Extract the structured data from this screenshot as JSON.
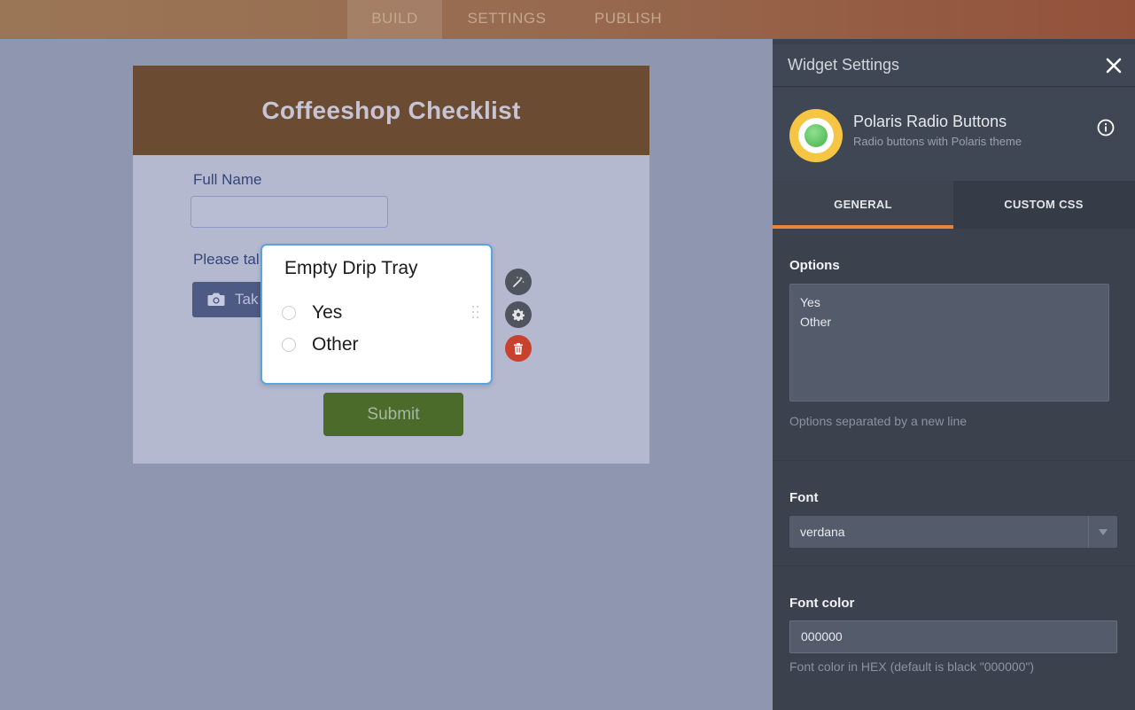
{
  "topbar": {
    "tabs": [
      {
        "label": "BUILD",
        "active": true
      },
      {
        "label": "SETTINGS",
        "active": false
      },
      {
        "label": "PUBLISH",
        "active": false
      }
    ]
  },
  "form": {
    "title": "Coffeeshop Checklist",
    "full_name_label": "Full Name",
    "photo_label": "Please tal",
    "photo_button": "Tak",
    "submit": "Submit"
  },
  "radio_widget": {
    "question": "Empty Drip Tray",
    "options": [
      "Yes",
      "Other"
    ]
  },
  "panel": {
    "title": "Widget Settings",
    "widget_name": "Polaris Radio Buttons",
    "widget_description": "Radio buttons with Polaris theme",
    "tabs": [
      {
        "label": "GENERAL",
        "active": true
      },
      {
        "label": "CUSTOM CSS",
        "active": false
      }
    ],
    "options_label": "Options",
    "options_value": "Yes\nOther",
    "options_hint": "Options separated by a new line",
    "font_label": "Font",
    "font_value": "verdana",
    "font_color_label": "Font color",
    "font_color_value": "000000",
    "font_color_hint": "Font color in HEX (default is black \"000000\")"
  },
  "colors": {
    "accent": "#e8853a",
    "delete": "#c8412c",
    "submit": "#4a6b2a",
    "header": "#6b4b32",
    "selection_border": "#5aa3dd"
  },
  "icons": [
    "camera-icon",
    "magic-wand-icon",
    "gear-icon",
    "trash-icon",
    "close-icon",
    "info-icon",
    "chevron-down-icon",
    "drag-handle-icon"
  ]
}
